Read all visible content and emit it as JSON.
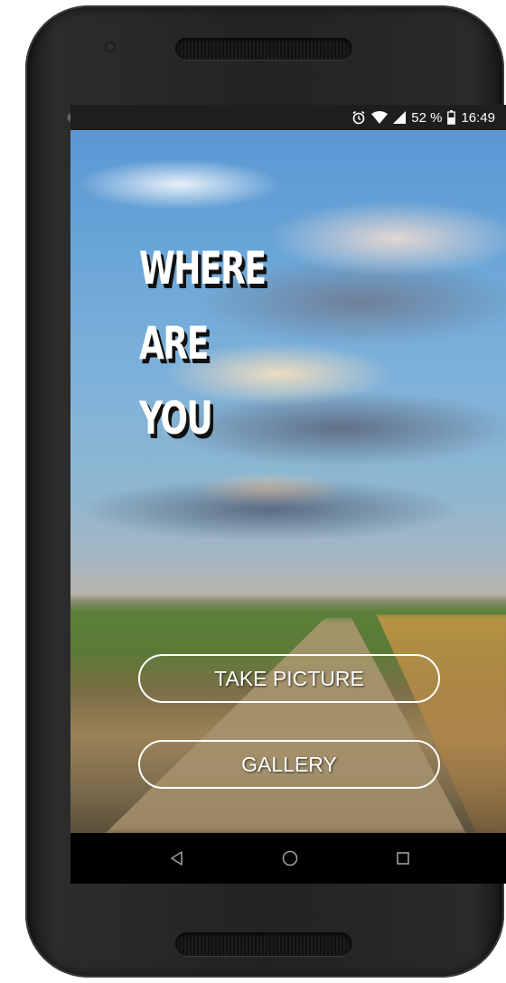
{
  "status_bar": {
    "battery_percent": "52 %",
    "time": "16:49",
    "icons": [
      "alarm-icon",
      "wifi-icon",
      "signal-icon",
      "battery-icon"
    ]
  },
  "main": {
    "headline_lines": [
      "WHERE",
      "ARE",
      "YOU"
    ],
    "take_picture_label": "TAKE PICTURE",
    "gallery_label": "GALLERY"
  },
  "nav_bar": {
    "icons": [
      "back-icon",
      "home-icon",
      "recents-icon"
    ]
  },
  "colors": {
    "button_border": "#ffffff",
    "text": "#ffffff",
    "nav_background": "#000000",
    "status_background": "#1e1e1e"
  }
}
